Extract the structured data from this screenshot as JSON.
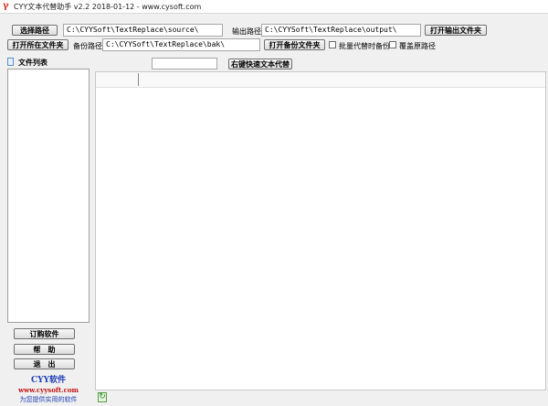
{
  "window": {
    "title": "CYY文本代替助手 v2.2 2018-01-12 - www.cysoft.com"
  },
  "toolbar": {
    "select_path_label": "选择路径",
    "source_path_value": "C:\\CYYSoft\\TextReplace\\source\\",
    "output_path_label": "输出路径",
    "output_path_value": "C:\\CYYSoft\\TextReplace\\output\\",
    "open_output_folder_label": "打开输出文件夹",
    "open_containing_folder_label": "打开所在文件夹",
    "backup_path_label": "备份路径",
    "backup_path_value": "C:\\CYYSoft\\TextReplace\\bak\\",
    "open_backup_folder_label": "打开备份文件夹",
    "batch_backup_label": "批量代替时备份",
    "overwrite_path_label": "覆盖原路径",
    "batch_backup_checked": false,
    "overwrite_path_checked": false
  },
  "search": {
    "input_value": ""
  },
  "right_click_replace_label": "右键快速文本代替",
  "file_list": {
    "title": "文件列表",
    "items": []
  },
  "sidebar_buttons": {
    "order": "订购软件",
    "help": "帮　助",
    "exit": "退　出"
  },
  "brand": {
    "title": "CYY软件",
    "site": "www.cyysoft.com",
    "slogan": "为您提供实用的软件"
  },
  "icons": {
    "app": "cyy-logo-icon",
    "file_list": "document-icon",
    "status": "refresh-icon"
  },
  "colors": {
    "brand_blue": "#1f3fb3",
    "brand_red": "#c01010",
    "app_red": "#d0342c"
  }
}
